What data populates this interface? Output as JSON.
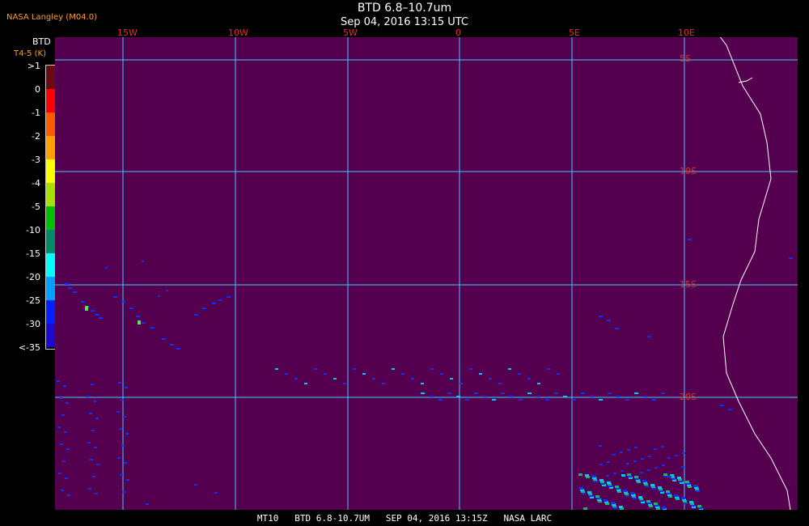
{
  "header": {
    "title": "BTD 6.8–10.7um",
    "datetime": "Sep 04, 2016 13:15 UTC",
    "org": "NASA Langley (M04.0)"
  },
  "legend": {
    "title": "BTD",
    "unit": "T4-5 (K)",
    "labels": [
      ">1",
      "0",
      "-1",
      "-2",
      "-3",
      "-4",
      "-5",
      "-10",
      "-15",
      "-20",
      "-25",
      "-30",
      "<-35"
    ],
    "colors": [
      "#6a0a12",
      "#ff0000",
      "#ff5a00",
      "#ffa000",
      "#ffff00",
      "#a8e000",
      "#00c000",
      "#008a6a",
      "#00ffff",
      "#00a0ff",
      "#0020ff",
      "#1a0ad0",
      "#5a0055"
    ]
  },
  "map": {
    "background": "#55004f",
    "grid_color": "#40c8ff",
    "coast_color": "#ffffff",
    "lon_labels": [
      "15W",
      "10W",
      "5W",
      "0",
      "5E",
      "10E"
    ],
    "lat_labels": [
      "5S",
      "10S",
      "15S",
      "20S"
    ]
  },
  "footer": "MT10   BTD 6.8-10.7UM   SEP 04, 2016 13:15Z   NASA LARC"
}
